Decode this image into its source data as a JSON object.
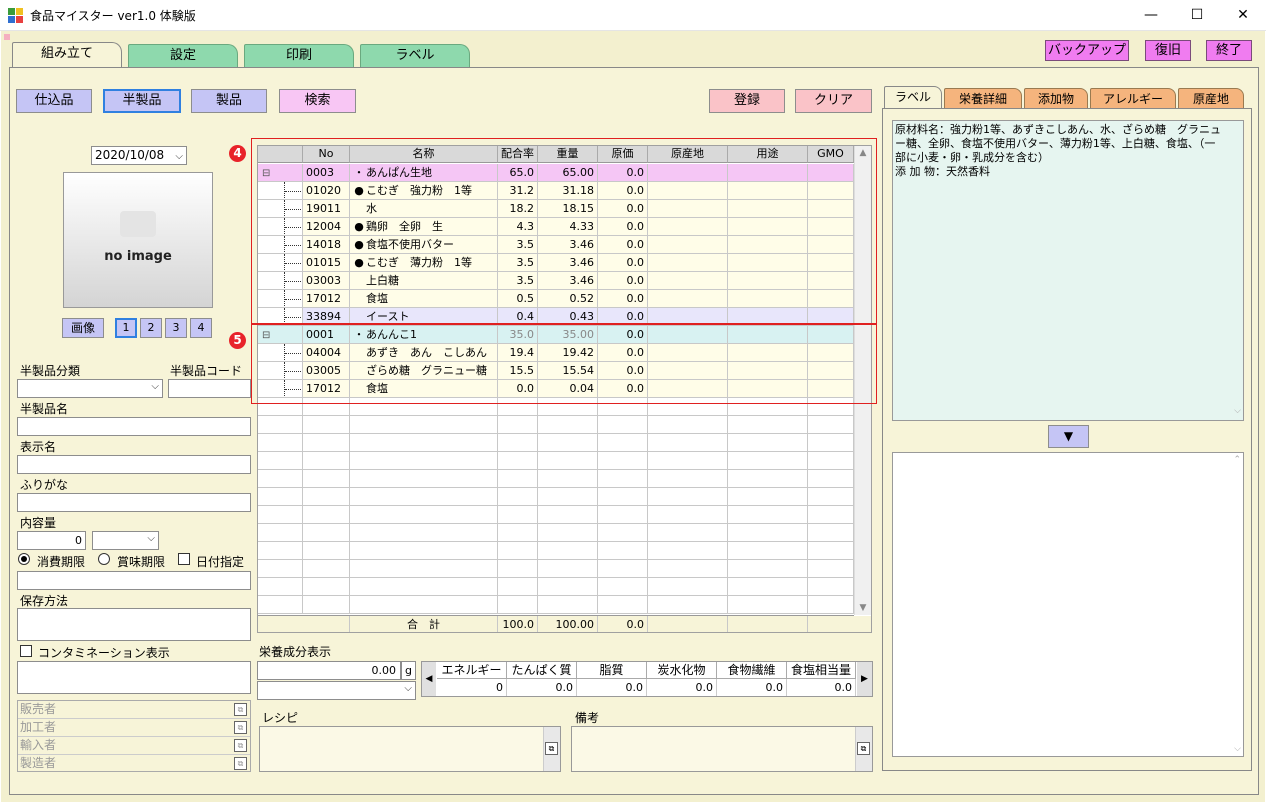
{
  "window": {
    "title": "食品マイスター ver1.0 体験版",
    "minimize": "—",
    "maximize": "☐",
    "close": "✕"
  },
  "tabs": [
    "組み立て",
    "設定",
    "印刷",
    "ラベル"
  ],
  "top_buttons": {
    "backup": "バックアップ",
    "restore": "復旧",
    "exit": "終了"
  },
  "mode_buttons": {
    "shikomi": "仕込品",
    "hanseihin": "半製品",
    "seihin": "製品",
    "search": "検索"
  },
  "action_buttons": {
    "register": "登録",
    "clear": "クリア"
  },
  "left": {
    "date": "2020/10/08",
    "no_image": "no image",
    "image_button": "画像",
    "image_pages": [
      "1",
      "2",
      "3",
      "4"
    ],
    "category_label": "半製品分類",
    "code_label": "半製品コード",
    "name_label": "半製品名",
    "display_name_label": "表示名",
    "furigana_label": "ふりがな",
    "content_label": "内容量",
    "content_value": "0",
    "expiry_consume": "消費期限",
    "expiry_best": "賞味期限",
    "date_specify": "日付指定",
    "storage_label": "保存方法",
    "contamination_label": "コンタミネーション表示",
    "parties": [
      "販売者",
      "加工者",
      "輸入者",
      "製造者"
    ]
  },
  "markers": {
    "four": "4",
    "five": "5"
  },
  "grid": {
    "headers": [
      "No",
      "名称",
      "配合率",
      "重量",
      "原価",
      "原産地",
      "用途",
      "GMO"
    ],
    "rows": [
      {
        "type": "parent",
        "no": "0003",
        "bullet": "・",
        "name": "あんぱん生地",
        "ratio": "65.0",
        "weight": "65.00",
        "cost": "0.0",
        "tree": "⊟"
      },
      {
        "type": "child",
        "no": "01020",
        "bullet": "●",
        "name": "こむぎ　強力粉　1等",
        "ratio": "31.2",
        "weight": "31.18",
        "cost": "0.0"
      },
      {
        "type": "child",
        "no": "19011",
        "bullet": "",
        "name": "水",
        "ratio": "18.2",
        "weight": "18.15",
        "cost": "0.0"
      },
      {
        "type": "child",
        "no": "12004",
        "bullet": "●",
        "name": "鶏卵　全卵　生",
        "ratio": "4.3",
        "weight": "4.33",
        "cost": "0.0"
      },
      {
        "type": "child",
        "no": "14018",
        "bullet": "●",
        "name": "食塩不使用バター",
        "ratio": "3.5",
        "weight": "3.46",
        "cost": "0.0"
      },
      {
        "type": "child",
        "no": "01015",
        "bullet": "●",
        "name": "こむぎ　薄力粉　1等",
        "ratio": "3.5",
        "weight": "3.46",
        "cost": "0.0"
      },
      {
        "type": "child",
        "no": "03003",
        "bullet": "",
        "name": "上白糖",
        "ratio": "3.5",
        "weight": "3.46",
        "cost": "0.0"
      },
      {
        "type": "child",
        "no": "17012",
        "bullet": "",
        "name": "食塩",
        "ratio": "0.5",
        "weight": "0.52",
        "cost": "0.0"
      },
      {
        "type": "child-sel",
        "no": "33894",
        "bullet": "",
        "name": "イースト",
        "ratio": "0.4",
        "weight": "0.43",
        "cost": "0.0"
      },
      {
        "type": "parent2",
        "no": "0001",
        "bullet": "・",
        "name": "あんんこ1",
        "ratio": "35.0",
        "weight": "35.00",
        "cost": "0.0",
        "tree": "⊟"
      },
      {
        "type": "child",
        "no": "04004",
        "bullet": "",
        "name": "あずき　あん　こしあん",
        "ratio": "19.4",
        "weight": "19.42",
        "cost": "0.0"
      },
      {
        "type": "child",
        "no": "03005",
        "bullet": "",
        "name": "ざらめ糖　グラニュー糖",
        "ratio": "15.5",
        "weight": "15.54",
        "cost": "0.0"
      },
      {
        "type": "child",
        "no": "17012",
        "bullet": "",
        "name": "食塩",
        "ratio": "0.0",
        "weight": "0.04",
        "cost": "0.0"
      }
    ],
    "total_label": "合　計",
    "total_ratio": "100.0",
    "total_weight": "100.00",
    "total_cost": "0.0"
  },
  "nutrition": {
    "label": "栄養成分表示",
    "amount": "0.00",
    "unit": "g",
    "headers": [
      "エネルギー",
      "たんぱく質",
      "脂質",
      "炭水化物",
      "食物繊維",
      "食塩相当量"
    ],
    "values": [
      "0",
      "0.0",
      "0.0",
      "0.0",
      "0.0",
      "0.0"
    ]
  },
  "recipe_label": "レシピ",
  "notes_label": "備考",
  "right": {
    "tabs": [
      "ラベル",
      "栄養詳細",
      "添加物",
      "アレルギー",
      "原産地"
    ],
    "label_text_1": "原材料名：強力粉1等、あずきこしあん、水、ざらめ糖　グラニュー糖、全卵、食塩不使用バター、薄力粉1等、上白糖、食塩、（一部に小麦・卵・乳成分を含む）",
    "label_text_2": "添 加 物：天然香料"
  },
  "colors": {
    "parent_row": "#f5c6f5",
    "parent2_row": "#d8f2f2",
    "child_row": "#fffde8",
    "selected_row": "#e8e6fb",
    "red_box": "#e02020"
  }
}
